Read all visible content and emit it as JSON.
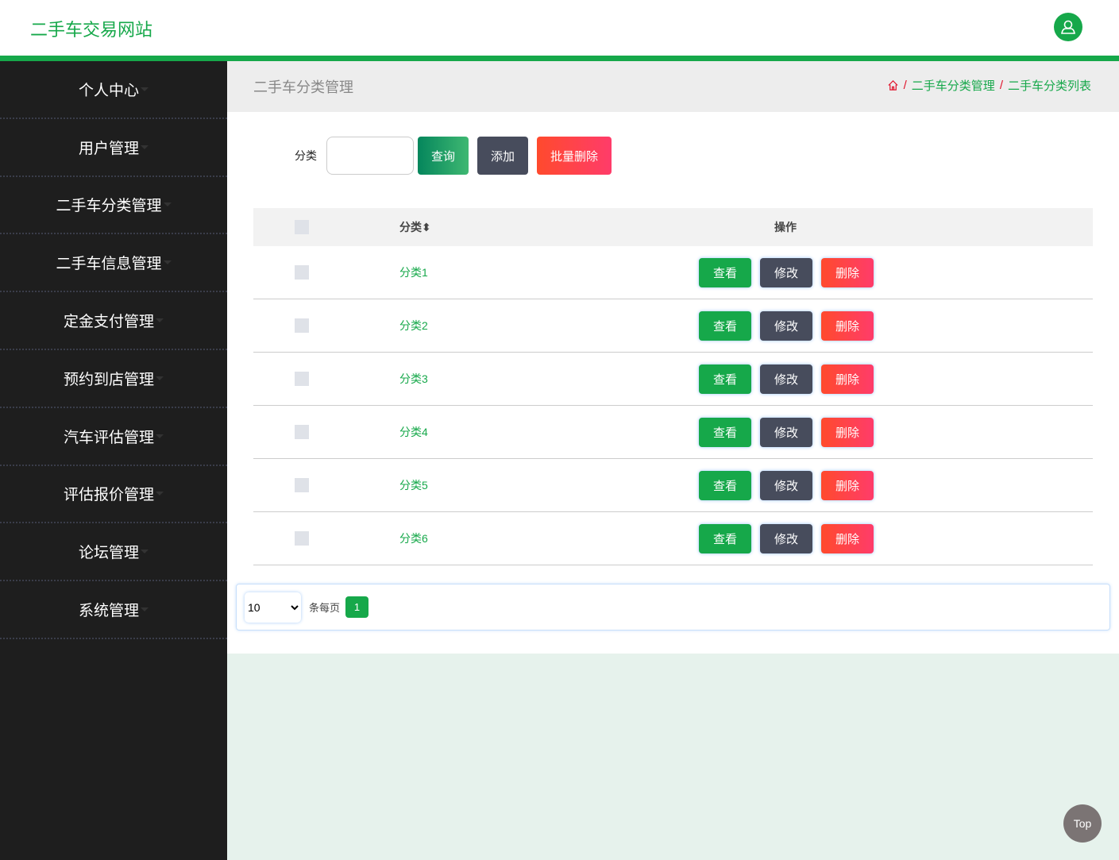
{
  "header": {
    "title": "二手车交易网站",
    "avatar_icon": "user-icon"
  },
  "sidebar": {
    "items": [
      {
        "label": "个人中心"
      },
      {
        "label": "用户管理"
      },
      {
        "label": "二手车分类管理"
      },
      {
        "label": "二手车信息管理"
      },
      {
        "label": "定金支付管理"
      },
      {
        "label": "预约到店管理"
      },
      {
        "label": "汽车评估管理"
      },
      {
        "label": "评估报价管理"
      },
      {
        "label": "论坛管理"
      },
      {
        "label": "系统管理"
      }
    ]
  },
  "breadcrumb": {
    "title": "二手车分类管理",
    "items": [
      "二手车分类管理",
      "二手车分类列表"
    ],
    "separator": "/"
  },
  "search": {
    "label": "分类",
    "value": "",
    "query": "查询",
    "add": "添加",
    "batch_delete": "批量删除"
  },
  "table": {
    "headers": {
      "name": "分类",
      "ops": "操作"
    },
    "rows": [
      {
        "name": "分类1"
      },
      {
        "name": "分类2"
      },
      {
        "name": "分类3"
      },
      {
        "name": "分类4"
      },
      {
        "name": "分类5"
      },
      {
        "name": "分类6"
      }
    ],
    "view": "查看",
    "edit": "修改",
    "delete": "删除"
  },
  "pagination": {
    "page_size": "10",
    "per_page_label": "条每页",
    "current_page": "1"
  },
  "back_to_top": "Top",
  "colors": {
    "primary": "#16a84a",
    "sidebar": "#1e1e1e",
    "danger": "#ff3c6a",
    "dark": "#474c5c"
  }
}
